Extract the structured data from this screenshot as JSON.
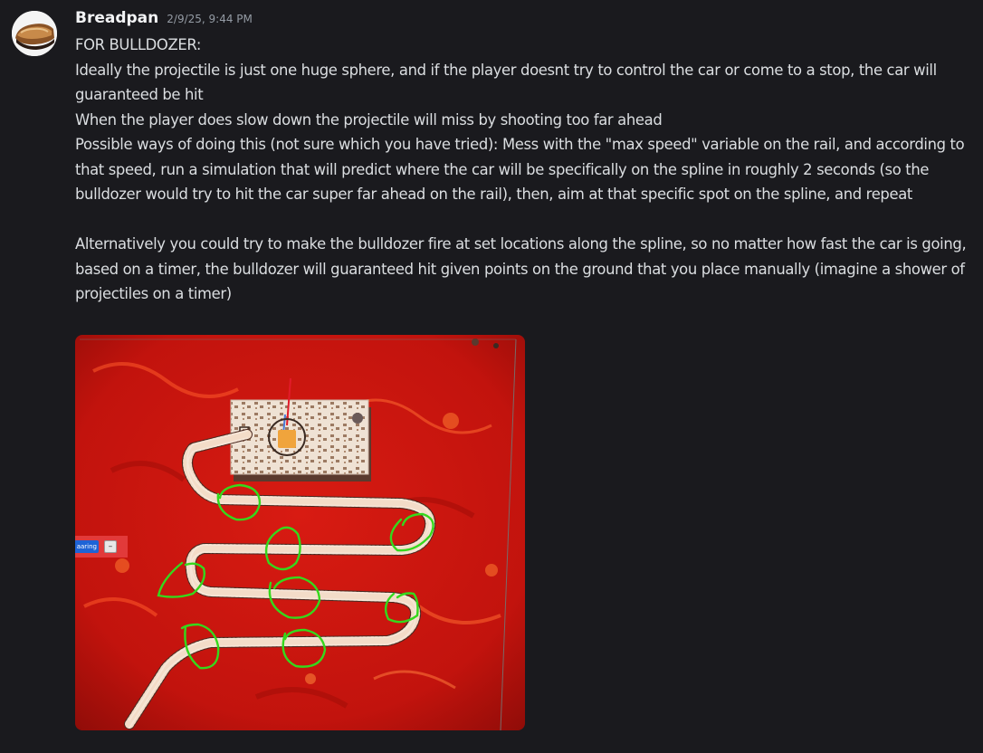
{
  "message": {
    "username": "Breadpan",
    "timestamp": "2/9/25, 9:44 PM",
    "avatar_icon": "bread-loaf-icon",
    "lines": [
      "FOR BULLDOZER:",
      "Ideally the projectile is just one huge sphere, and if the player doesnt try to control the car or come to a stop, the car will guaranteed be hit",
      "When the player does slow down the projectile will miss by shooting too far ahead",
      "Possible ways of doing this (not sure which you have tried): Mess with the \"max speed\" variable on the rail, and according to that speed, run a simulation that will predict where the car will be specifically on the spline in roughly 2 seconds (so the bulldozer would try to hit the car super far ahead on the rail), then, aim at that specific spot on the spline, and repeat",
      "",
      "Alternatively you could try to make the bulldozer fire at set locations along the spline, so no matter how fast the car is going, based on a timer, the bulldozer will guaranteed hit given points on the ground that you place manually (imagine a shower of projectiles on a timer)"
    ]
  },
  "attachment": {
    "type": "image",
    "mini_ui_label": "aaring",
    "mini_ui_button": "–",
    "colors": {
      "lava": "#c8150f",
      "rail": "#f3dcc8",
      "annotation": "#35d81c"
    }
  },
  "theme": {
    "background": "#1a1a1e",
    "text": "#dbdee1",
    "username": "#f2f3f5",
    "timestamp": "#949ba4"
  }
}
